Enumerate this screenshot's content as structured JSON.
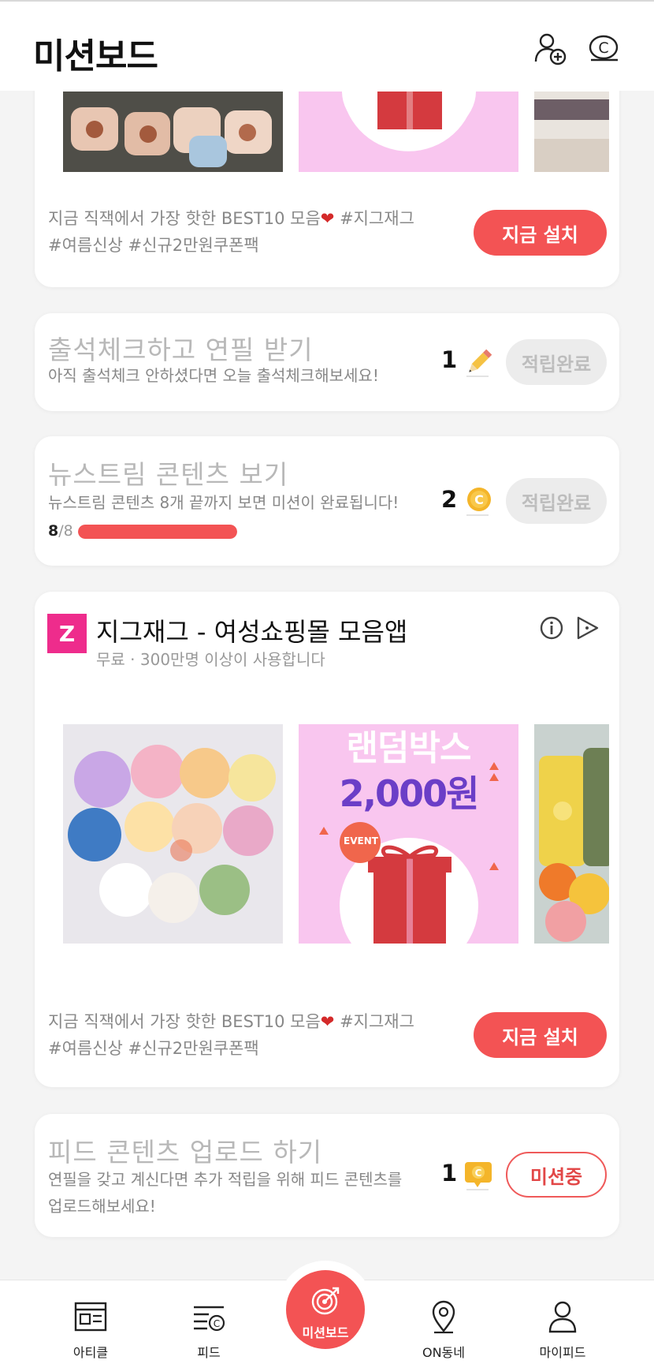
{
  "header": {
    "title": "미션보드",
    "add_user_icon": "add-user-icon",
    "coin_icon": "coin-icon"
  },
  "ad_top": {
    "description": "지금 직잭에서 가장 핫한 BEST10 모음",
    "heart": "❤",
    "tag1": " #지그재그",
    "tags2": "#여름신상 #신규2만원쿠폰팩",
    "install_label": "지금 설치"
  },
  "missions": [
    {
      "title": "출석체크하고 연필 받기",
      "subtitle": "아직 출석체크 안하셨다면 오늘 출석체크해보세요!",
      "reward_count": "1",
      "reward_icon": "pencil-icon",
      "status_label": "적립완료"
    },
    {
      "title": "뉴스트림 콘텐츠 보기",
      "subtitle": "뉴스트림 콘텐츠 8개 끝까지 보면 미션이 완료됩니다!",
      "reward_count": "2",
      "reward_icon": "coin-icon",
      "status_label": "적립완료",
      "progress_current": "8",
      "progress_total": "/8",
      "progress_fraction": 1.0
    },
    {
      "title": "피드 콘텐츠 업로드 하기",
      "subtitle_line1": "연필을 갖고 계신다면 추가 적립을 위해 피드 콘텐츠를",
      "subtitle_line2": "업로드해보세요!",
      "reward_count": "1",
      "reward_icon": "chat-coin-icon",
      "status_label": "미션중"
    }
  ],
  "ad_main": {
    "logo_letter": "Z",
    "app_name": "지그재그 - 여성쇼핑몰 모음앱",
    "app_meta": "무료 · 300만명 이상이 사용합니다",
    "promo_line1": "랜덤박스",
    "promo_line2": "2,000원",
    "promo_badge": "EVENT",
    "description": "지금 직잭에서 가장 핫한 BEST10 모음",
    "heart": "❤",
    "tag1": " #지그재그",
    "tags2": "#여름신상 #신규2만원쿠폰팩",
    "install_label": "지금 설치",
    "info_icon": "info-icon",
    "ad_choices_icon": "ad-choices-icon"
  },
  "bottom_nav": {
    "items": [
      {
        "label": "아티클",
        "icon": "article-icon"
      },
      {
        "label": "피드",
        "icon": "feed-icon"
      },
      {
        "label": "미션보드",
        "icon": "target-icon"
      },
      {
        "label": "ON동네",
        "icon": "location-icon"
      },
      {
        "label": "마이피드",
        "icon": "person-icon"
      }
    ]
  },
  "colors": {
    "accent": "#f35354",
    "background": "#f4f4f4",
    "logo_pink": "#ee2c8c",
    "promo_bg": "#f9c6ef",
    "gift_red": "#d43a3f"
  }
}
